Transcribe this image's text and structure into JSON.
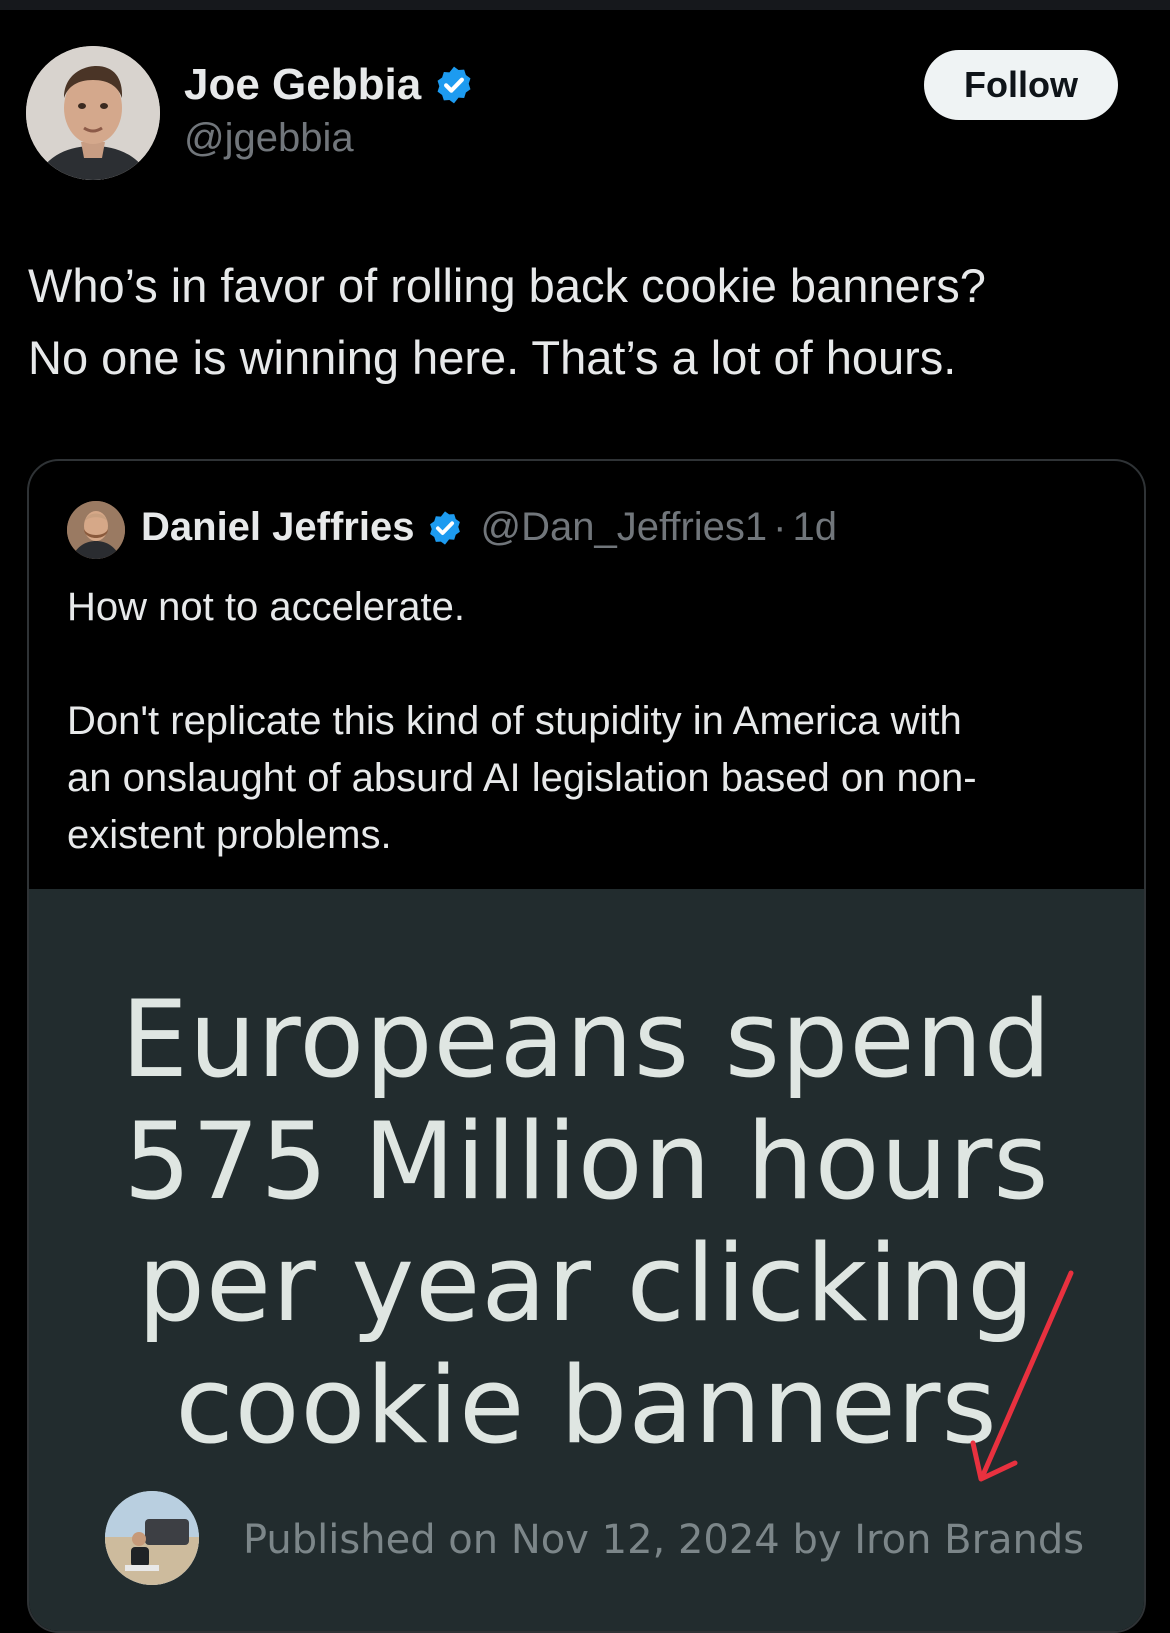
{
  "colors": {
    "background": "#000000",
    "verified_badge": "#1d9bf0",
    "follow_button_bg": "#eff3f4",
    "image_bg": "#222c2e",
    "annotation_arrow": "#e8313f"
  },
  "tweet": {
    "author_name": "Joe Gebbia",
    "author_handle": "@jgebbia",
    "verified_icon": "verified-badge-icon",
    "follow_label": "Follow",
    "text_lines": [
      "Who’s in favor of rolling back cookie banners?",
      "No one is winning here. That’s a lot of hours."
    ]
  },
  "quote": {
    "author_name": "Daniel Jeffries",
    "author_handle": "@Dan_Jeffries1",
    "separator": "·",
    "time": "1d",
    "text_lines": [
      "How not to accelerate.",
      "",
      "Don't replicate this kind of stupidity in America with",
      "an onslaught of absurd AI legislation based on non-",
      "existent problems."
    ],
    "image": {
      "headline_lines": [
        "Europeans spend",
        "575 Million hours",
        "per year clicking",
        "cookie banners"
      ],
      "published_text": "Published on Nov 12, 2024 by Iron Brands",
      "annotation": "red-arrow-pointing-to-publisher"
    }
  }
}
